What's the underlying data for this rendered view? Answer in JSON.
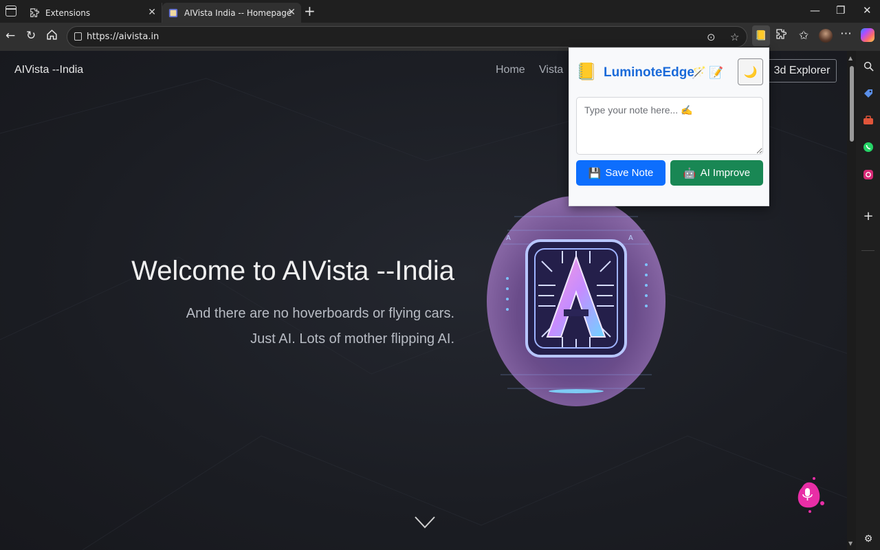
{
  "browser": {
    "tabs": [
      {
        "title": "Extensions",
        "icon": "puzzle-icon",
        "active": false
      },
      {
        "title": "AIVista India -- Homepage",
        "icon": "site-favicon",
        "active": true
      }
    ],
    "url": "https://aivista.in",
    "accent": "#303030"
  },
  "site": {
    "brand": "AIVista --India",
    "nav": [
      "Home",
      "Vista"
    ],
    "explorer_button": "3d Explorer",
    "hero": {
      "title": "Welcome to AIVista --India",
      "subtitle_line1": "And there are no hoverboards or flying cars.",
      "subtitle_line2": "Just AI. Lots of mother flipping AI."
    }
  },
  "popup": {
    "title": "LuminoteEdge",
    "title_color": "#1a6ad9",
    "placeholder": "Type your note here... ✍️",
    "save_label": "Save Note",
    "save_icon": "💾",
    "ai_label": "AI Improve",
    "ai_icon": "🤖",
    "theme_icon": "🌙",
    "save_color": "#0d6efd",
    "ai_color": "#198754"
  }
}
